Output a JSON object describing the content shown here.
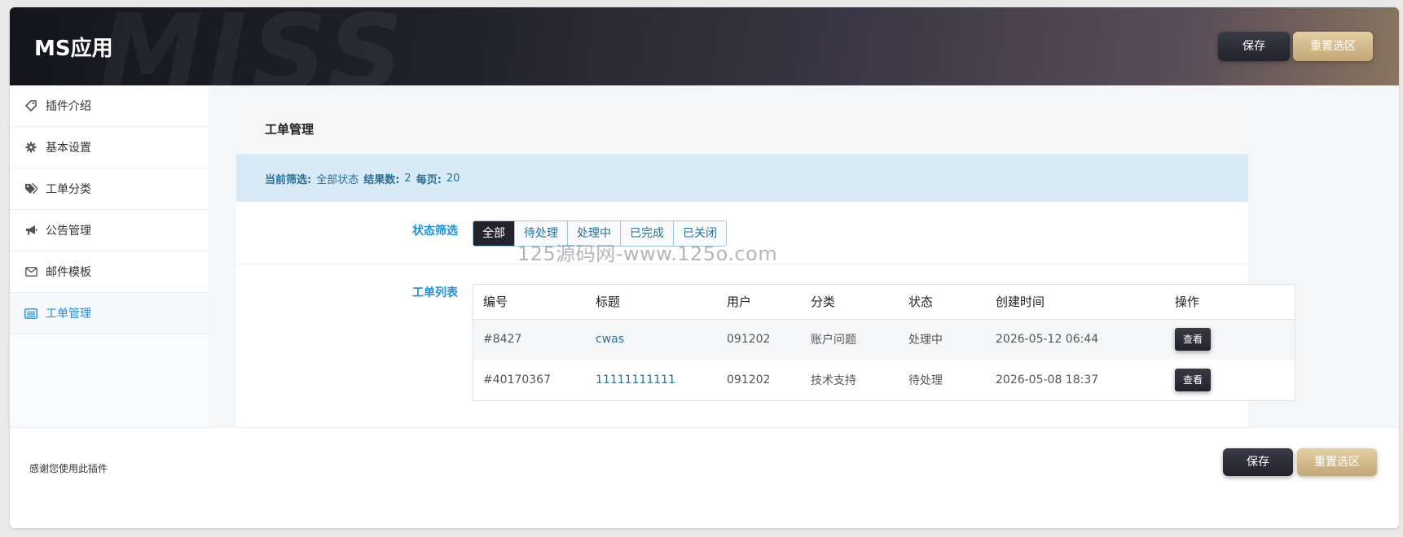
{
  "app": {
    "title": "MS应用",
    "header_watermark": "MISS",
    "save_label": "保存",
    "reset_label": "重置选区"
  },
  "sidebar": {
    "items": [
      {
        "label": "插件介绍",
        "icon": "tag-icon"
      },
      {
        "label": "基本设置",
        "icon": "gear-icon"
      },
      {
        "label": "工单分类",
        "icon": "tags-icon"
      },
      {
        "label": "公告管理",
        "icon": "megaphone-icon"
      },
      {
        "label": "邮件模板",
        "icon": "envelope-icon"
      },
      {
        "label": "工单管理",
        "icon": "list-icon",
        "active": true
      }
    ]
  },
  "panel": {
    "title": "工单管理",
    "filter": {
      "current_label": "当前筛选:",
      "current_value": "全部状态",
      "result_label": "结果数:",
      "result_value": "2",
      "per_page_label": "每页:",
      "per_page_value": "20"
    },
    "status_filter": {
      "label": "状态筛选",
      "options": [
        "全部",
        "待处理",
        "处理中",
        "已完成",
        "已关闭"
      ],
      "selected": "全部"
    },
    "watermark_text": "125源码网-www.125o.com",
    "ticket_list": {
      "label": "工单列表",
      "columns": [
        "编号",
        "标题",
        "用户",
        "分类",
        "状态",
        "创建时间",
        "操作"
      ],
      "rows": [
        {
          "id": "#8427",
          "title": "cwas",
          "user": "091202",
          "category": "账户问题",
          "status": "处理中",
          "created": "2026-05-12 06:44",
          "action": "查看"
        },
        {
          "id": "#40170367",
          "title": "11111111111",
          "user": "091202",
          "category": "技术支持",
          "status": "待处理",
          "created": "2026-05-08 18:37",
          "action": "查看"
        }
      ]
    }
  },
  "footer": {
    "thanks": "感谢您使用此插件",
    "save_label": "保存",
    "reset_label": "重置选区"
  },
  "colors": {
    "accent": "#1e90d6",
    "dark_button": "#23232d",
    "gold_button": "#c2a676",
    "info_bg": "#d8eaf5"
  }
}
